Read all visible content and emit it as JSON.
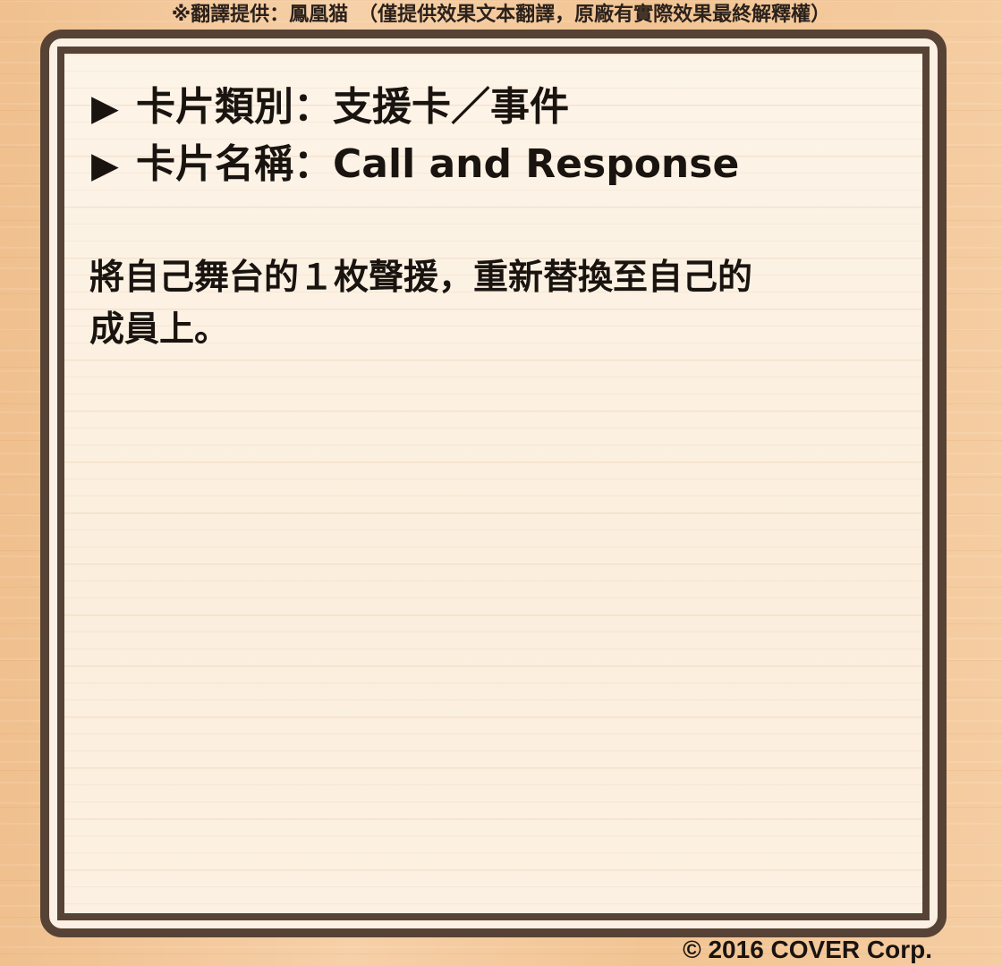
{
  "translator_note": "※翻譯提供：鳳凰猫　（僅提供效果文本翻譯，原廠有實際效果最終解釋權）",
  "card": {
    "bullet": "▶",
    "type_line": "卡片類別：支援卡／事件",
    "name_line": "卡片名稱：Call and Response",
    "effect_text": "將自己舞台的１枚聲援，重新替換至自己的\n成員上。"
  },
  "copyright": "© 2016 COVER Corp."
}
